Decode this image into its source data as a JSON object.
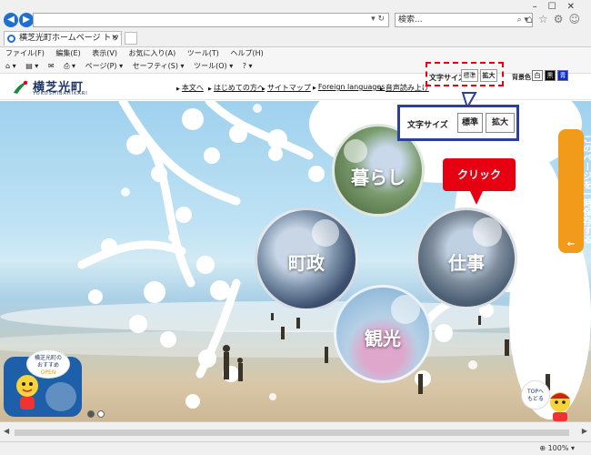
{
  "browser": {
    "url_value": "",
    "search_placeholder": "検索...",
    "tab_title": "横芝光町ホームページ トップペ...",
    "menu": [
      "ファイル(F)",
      "編集(E)",
      "表示(V)",
      "お気に入り(A)",
      "ツール(T)",
      "ヘルプ(H)"
    ],
    "commands": [
      "ページ(P) ▾",
      "セーフティ(S) ▾",
      "ツール(O) ▾"
    ],
    "zoom": "100%"
  },
  "site": {
    "logo_text": "横芝光町",
    "logo_sub": "YOKOSHIBAHIKARI",
    "nav": [
      "本文へ",
      "はじめての方へ",
      "サイトマップ",
      "Foreign languages",
      "音声読み上げ"
    ],
    "font_size_label": "文字サイズ",
    "font_standard": "標準",
    "font_large": "拡大",
    "bg_label": "背景色",
    "bg_white": "白",
    "bg_black": "黒",
    "bg_blue": "青"
  },
  "hero": {
    "categories": [
      "暮らし",
      "町政",
      "仕事",
      "観光"
    ],
    "popup_label": "文字サイズ",
    "popup_standard": "標準",
    "popup_large": "拡大",
    "click_label": "クリック",
    "save_tab": "このページを一時保存する",
    "save_arrow": "←",
    "mascot_line1": "横芝光町の",
    "mascot_line2": "おすすめ",
    "mascot_open": "OPEN",
    "top_line1": "TOPへ",
    "top_line2": "もどる"
  }
}
